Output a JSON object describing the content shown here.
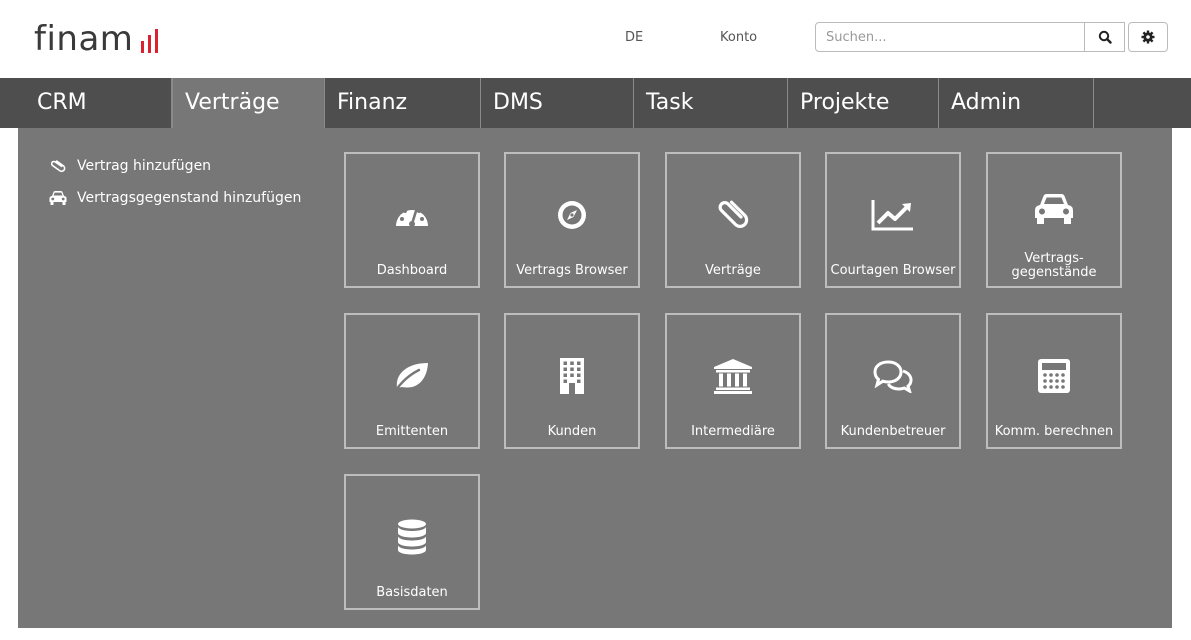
{
  "header": {
    "logo_text": "finam",
    "language": "DE",
    "account": "Konto",
    "search_placeholder": "Suchen..."
  },
  "nav": {
    "items": [
      {
        "label": "CRM"
      },
      {
        "label": "Verträge",
        "active": true
      },
      {
        "label": "Finanz"
      },
      {
        "label": "DMS"
      },
      {
        "label": "Task"
      },
      {
        "label": "Projekte"
      },
      {
        "label": "Admin"
      }
    ]
  },
  "sidebar": {
    "links": [
      {
        "label": "Vertrag hinzufügen",
        "icon": "paperclip-icon"
      },
      {
        "label": "Vertragsgegenstand hinzufügen",
        "icon": "car-icon"
      }
    ]
  },
  "tiles": [
    {
      "label": "Dashboard",
      "icon": "dashboard-icon"
    },
    {
      "label": "Vertrags Browser",
      "icon": "compass-icon"
    },
    {
      "label": "Verträge",
      "icon": "paperclip-icon"
    },
    {
      "label": "Courtagen Browser",
      "icon": "line-chart-icon"
    },
    {
      "label": "Vertrags-",
      "label2": "gegenstände",
      "icon": "car-icon"
    },
    {
      "label": "Emittenten",
      "icon": "leaf-icon"
    },
    {
      "label": "Kunden",
      "icon": "building-icon"
    },
    {
      "label": "Intermediäre",
      "icon": "bank-icon"
    },
    {
      "label": "Kundenbetreuer",
      "icon": "comments-icon"
    },
    {
      "label": "Komm. berechnen",
      "icon": "calculator-icon"
    },
    {
      "label": "Basisdaten",
      "icon": "database-icon"
    }
  ],
  "colors": {
    "nav_bg": "#4e4e4e",
    "panel_bg": "#777777",
    "logo_accent": "#d9232e"
  }
}
